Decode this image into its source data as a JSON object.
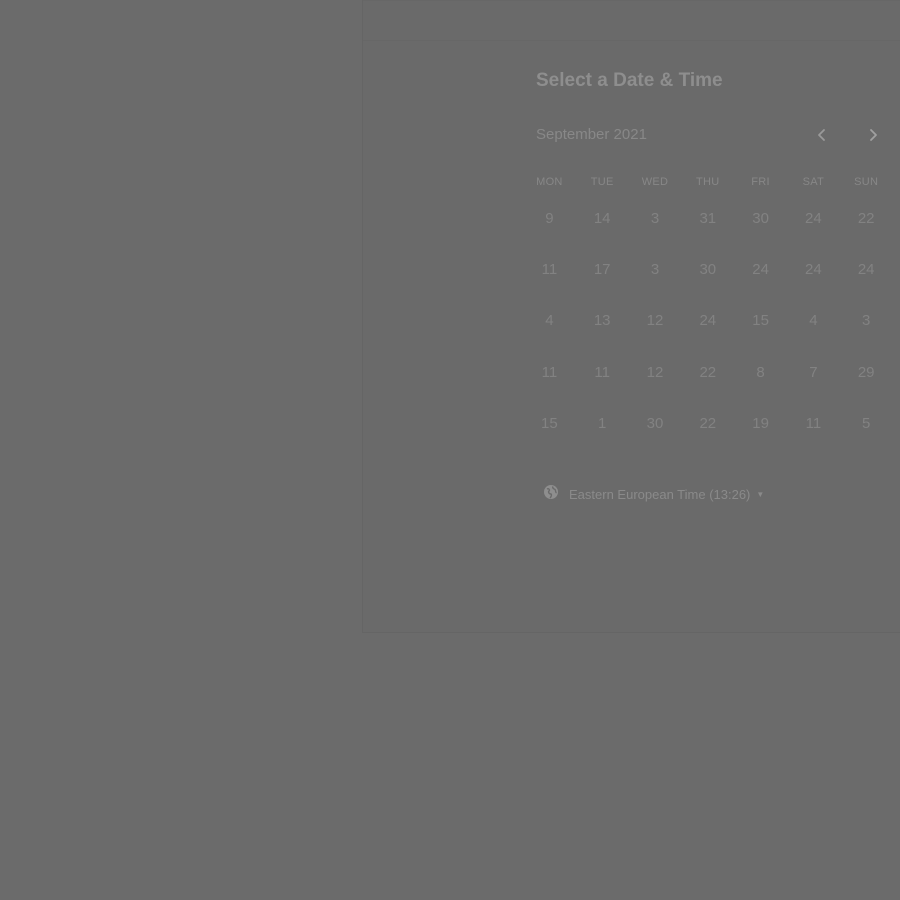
{
  "scheduler": {
    "title": "Select a Date & Time",
    "month_label": "September 2021",
    "prev_icon": "chevron-left-icon",
    "next_icon": "chevron-right-icon",
    "weekdays": [
      "MON",
      "TUE",
      "WED",
      "THU",
      "FRI",
      "SAT",
      "SUN"
    ],
    "weeks": [
      [
        "9",
        "14",
        "3",
        "31",
        "30",
        "24",
        "22"
      ],
      [
        "11",
        "17",
        "3",
        "30",
        "24",
        "24",
        "24"
      ],
      [
        "4",
        "13",
        "12",
        "24",
        "15",
        "4",
        "3"
      ],
      [
        "11",
        "11",
        "12",
        "22",
        "8",
        "7",
        "29"
      ],
      [
        "15",
        "1",
        "30",
        "22",
        "19",
        "11",
        "5"
      ]
    ],
    "timezone": {
      "icon": "globe-icon",
      "label": "Eastern European Time (13:26)",
      "caret_icon": "caret-down-icon"
    }
  }
}
